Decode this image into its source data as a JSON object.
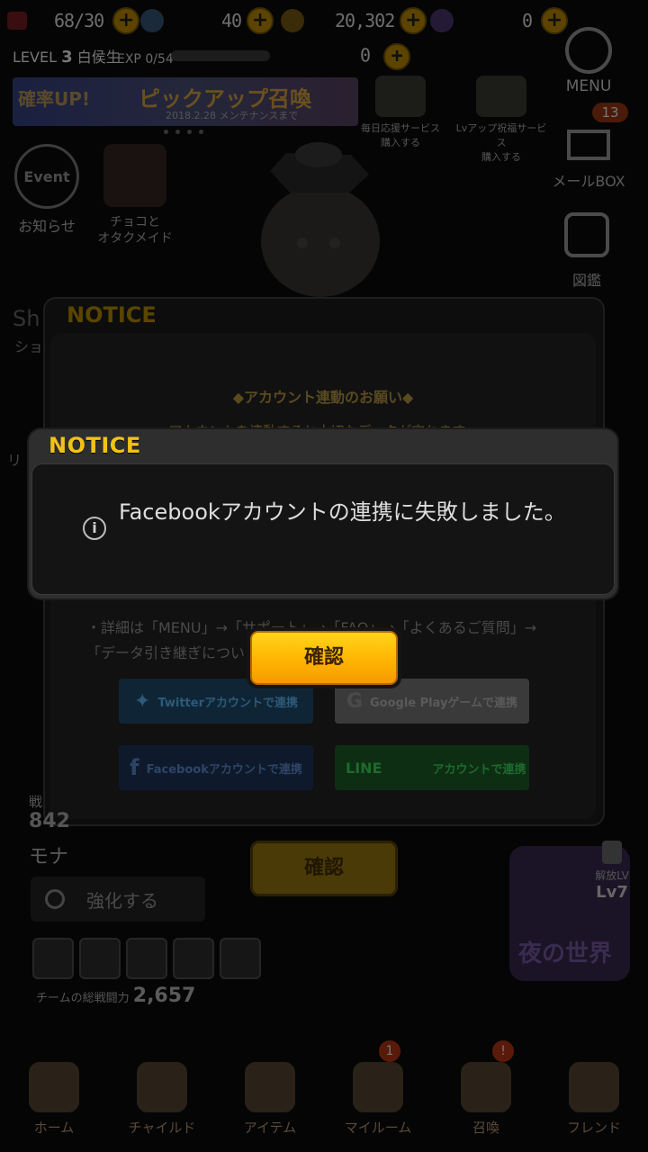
{
  "status": {
    "stamina": "68/30",
    "potion": "40",
    "coins": "20,302",
    "gems": "0",
    "level_label": "LEVEL",
    "level": "3",
    "title": "白侯生",
    "exp": "EXP 0/54",
    "stamina2": "0"
  },
  "banner": {
    "tag": "確率UP!",
    "title": "ピックアップ召喚",
    "date": "2018.2.28 メンテナンスまで"
  },
  "services": [
    {
      "label1": "毎日応援サービス",
      "label2": "購入する"
    },
    {
      "label1": "Lvアップ祝福サービス",
      "label2": "購入する"
    }
  ],
  "side_menu": {
    "menu": "MENU",
    "mail_badge": "13",
    "mail": "メールBOX",
    "zukan": "図鑑"
  },
  "left_icons": {
    "event_ring": "Event",
    "notice": "お知らせ",
    "choco1": "チョコと",
    "choco2": "オタクメイド",
    "shop_partial": "Sh",
    "shop_label": "ショ",
    "li_partial": "リ"
  },
  "back_dialog": {
    "header": "NOTICE",
    "heading": "◆アカウント連動のお願い◆",
    "text": "アカウントを連動すると大切なデータが守れます。",
    "detail1": "・詳細は「MENU」→「サポート」→「FAQ」→「よくあるご質問」→",
    "detail2": "「データ引き継ぎについ",
    "twitter": "Twitterアカウントで連携",
    "google": "Google Playゲームで連携",
    "facebook": "Facebookアカウントで連携",
    "line_logo": "LINE",
    "line": "アカウントで連携",
    "confirm": "確認"
  },
  "dialog": {
    "header": "NOTICE",
    "message": "Facebookアカウントの連携に失敗しました。",
    "confirm": "確認"
  },
  "home": {
    "senryoku": "戦",
    "power": "842",
    "name": "モナ",
    "enhance": "強化する",
    "team_label": "チームの総戦闘力",
    "team_power": "2,657",
    "night_title": "夜の世界",
    "lock_label": "解放LV",
    "lock_level": "Lv7"
  },
  "nav": [
    {
      "label": "ホーム",
      "badge": ""
    },
    {
      "label": "チャイルド",
      "badge": ""
    },
    {
      "label": "アイテム",
      "badge": ""
    },
    {
      "label": "マイルーム",
      "badge": "1"
    },
    {
      "label": "召喚",
      "badge": "!"
    },
    {
      "label": "フレンド",
      "badge": ""
    }
  ]
}
